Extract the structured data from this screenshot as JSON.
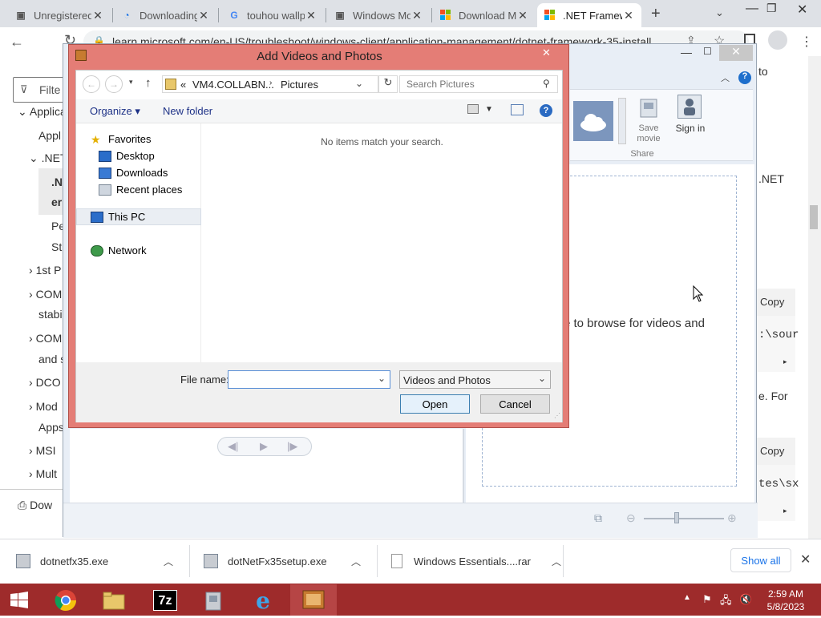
{
  "browser": {
    "tabs": [
      {
        "label": "Unregistered",
        "icon": "document-icon"
      },
      {
        "label": "Downloading",
        "icon": "loading-icon"
      },
      {
        "label": "touhou wallp",
        "icon": "google-icon"
      },
      {
        "label": "Windows Mo",
        "icon": "document-icon"
      },
      {
        "label": "Download M",
        "icon": "microsoft-icon"
      },
      {
        "label": ".NET Framew",
        "icon": "microsoft-icon"
      }
    ],
    "url": "learn.microsoft.com/en-US/troubleshoot/windows-client/application-management/dotnet-framework-35-install"
  },
  "page": {
    "filter_placeholder": "Filte",
    "sidebar": [
      "Applica",
      "Appl",
      ".NET",
      ".N",
      "er",
      "Pe",
      "St",
      "1st P",
      "COM",
      "stabi",
      "COM",
      "and s",
      "DCO",
      "Mod",
      "Apps",
      "MSI",
      "Mult"
    ],
    "download_link": "Dow",
    "right_texts": [
      "to",
      ".NET",
      "e. For"
    ],
    "copy_label": "Copy",
    "code1": ":\\sour",
    "code2": "tes\\sx"
  },
  "wmm": {
    "save_movie": "Save movie",
    "sign_in": "Sign in",
    "share_group": "Share",
    "browse_text": "re to browse for videos and"
  },
  "dialog": {
    "title": "Add Videos and Photos",
    "path_prefix": "«",
    "path_parent": "VM4.COLLABN...",
    "path_current": "Pictures",
    "search_placeholder": "Search Pictures",
    "organize": "Organize",
    "new_folder": "New folder",
    "empty_message": "No items match your search.",
    "nav": {
      "favorites": "Favorites",
      "desktop": "Desktop",
      "downloads": "Downloads",
      "recent": "Recent places",
      "this_pc": "This PC",
      "network": "Network"
    },
    "file_name_label": "File name:",
    "file_name_value": "",
    "file_type": "Videos and Photos",
    "open": "Open",
    "cancel": "Cancel"
  },
  "downloads": {
    "items": [
      "dotnetfx35.exe",
      "dotNetFx35setup.exe",
      "Windows Essentials....rar"
    ],
    "show_all": "Show all"
  },
  "taskbar": {
    "time": "2:59 AM",
    "date": "5/8/2023"
  }
}
